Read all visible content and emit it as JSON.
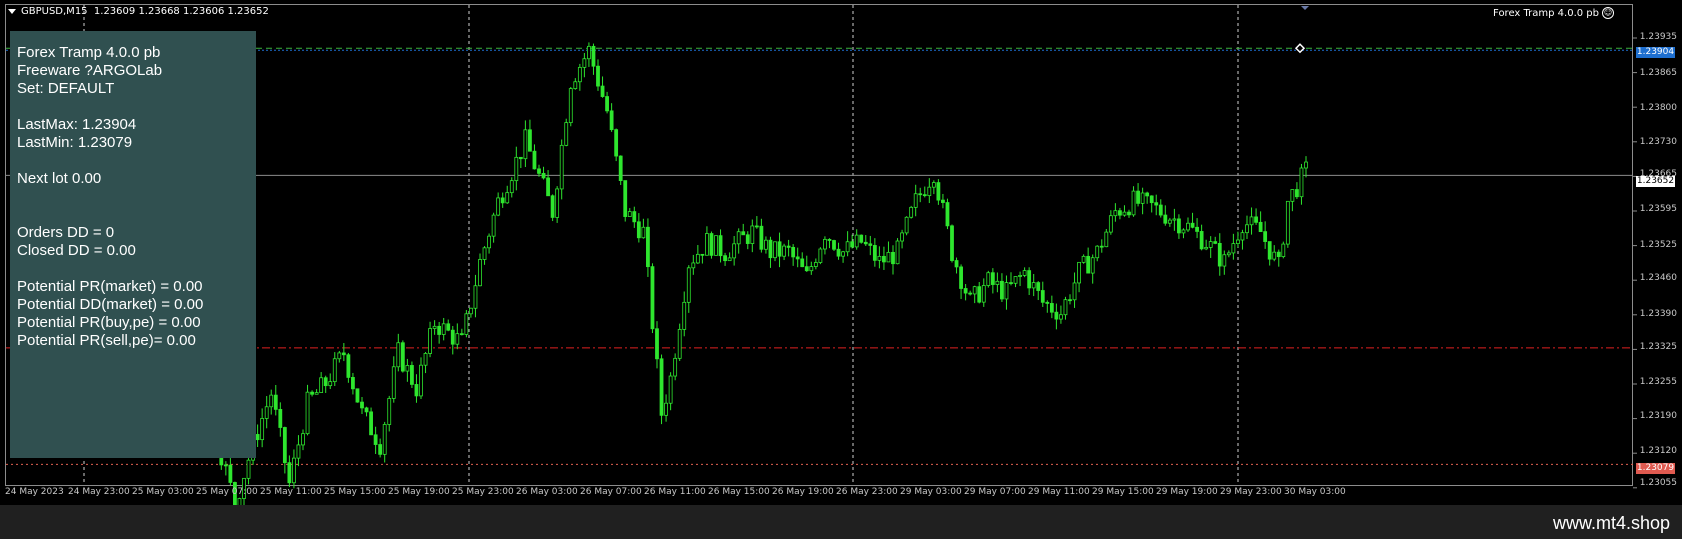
{
  "header": {
    "symbol": "GBPUSD,M15",
    "ohlc": "1.23609 1.23668 1.23606 1.23652",
    "ea_name": "Forex Tramp 4.0.0 pb"
  },
  "panel": {
    "title": "Forex Tramp 4.0.0 pb",
    "vendor": "Freeware ?ARGOLab",
    "set": "Set: DEFAULT",
    "last_max": "LastMax: 1.23904",
    "last_min": "LastMin: 1.23079",
    "next_lot": "Next lot 0.00",
    "orders_dd": "Orders DD = 0",
    "closed_dd": "Closed DD = 0.00",
    "pot_pr_market": "Potential PR(market) = 0.00",
    "pot_dd_market": "Potential DD(market) = 0.00",
    "pot_pr_buy": "Potential PR(buy,pe) = 0.00",
    "pot_pr_sell": "Potential PR(sell,pe)= 0.00"
  },
  "price_axis": [
    "1.23935",
    "1.23865",
    "1.23800",
    "1.23730",
    "1.23665",
    "1.23595",
    "1.23525",
    "1.23460",
    "1.23390",
    "1.23325",
    "1.23255",
    "1.23190",
    "1.23120",
    "1.23055"
  ],
  "price_tags": {
    "max": "1.23904",
    "current": "1.23652",
    "min": "1.23079"
  },
  "time_axis": [
    "24 May 2023",
    "24 May 23:00",
    "25 May 03:00",
    "25 May 07:00",
    "25 May 11:00",
    "25 May 15:00",
    "25 May 19:00",
    "25 May 23:00",
    "26 May 03:00",
    "26 May 07:00",
    "26 May 11:00",
    "26 May 15:00",
    "26 May 19:00",
    "26 May 23:00",
    "29 May 03:00",
    "29 May 07:00",
    "29 May 11:00",
    "29 May 15:00",
    "29 May 19:00",
    "29 May 23:00",
    "30 May 03:00"
  ],
  "chart_data": {
    "type": "candlestick",
    "symbol": "GBPUSD",
    "timeframe": "M15",
    "ylim": [
      1.2304,
      1.2396
    ],
    "levels": {
      "last_max": 1.23904,
      "last_min": 1.23079,
      "current": 1.23652,
      "sell_level": 1.2331
    },
    "close_path": [
      [
        0,
        1.236
      ],
      [
        4,
        1.2366
      ],
      [
        6,
        1.2378
      ],
      [
        8,
        1.2372
      ],
      [
        10,
        1.236
      ],
      [
        12,
        1.2356
      ],
      [
        13,
        1.2374
      ],
      [
        15,
        1.2358
      ],
      [
        17,
        1.2342
      ],
      [
        20,
        1.2325
      ],
      [
        22,
        1.232
      ],
      [
        25,
        1.23
      ],
      [
        27,
        1.2312
      ],
      [
        29,
        1.2322
      ],
      [
        31,
        1.2304
      ],
      [
        33,
        1.232
      ],
      [
        35,
        1.2324
      ],
      [
        37,
        1.233
      ],
      [
        39,
        1.2318
      ],
      [
        41,
        1.2312
      ],
      [
        43,
        1.233
      ],
      [
        45,
        1.2323
      ],
      [
        47,
        1.2336
      ],
      [
        50,
        1.2332
      ],
      [
        52,
        1.2348
      ],
      [
        54,
        1.236
      ],
      [
        57,
        1.2372
      ],
      [
        60,
        1.2358
      ],
      [
        62,
        1.2384
      ],
      [
        64,
        1.239
      ],
      [
        66,
        1.2378
      ],
      [
        68,
        1.2358
      ],
      [
        70,
        1.2354
      ],
      [
        72,
        1.2318
      ],
      [
        73,
        1.2325
      ],
      [
        75,
        1.2348
      ],
      [
        77,
        1.2352
      ],
      [
        79,
        1.235
      ],
      [
        82,
        1.2354
      ],
      [
        84,
        1.235
      ],
      [
        86,
        1.235
      ],
      [
        88,
        1.2345
      ],
      [
        90,
        1.2354
      ],
      [
        92,
        1.235
      ],
      [
        94,
        1.2352
      ],
      [
        96,
        1.2348
      ],
      [
        98,
        1.235
      ],
      [
        100,
        1.236
      ],
      [
        102,
        1.2366
      ],
      [
        104,
        1.235
      ],
      [
        106,
        1.234
      ],
      [
        108,
        1.2344
      ],
      [
        110,
        1.2342
      ],
      [
        112,
        1.2346
      ],
      [
        114,
        1.234
      ],
      [
        116,
        1.2338
      ],
      [
        118,
        1.2346
      ],
      [
        120,
        1.235
      ],
      [
        122,
        1.2358
      ],
      [
        124,
        1.236
      ],
      [
        126,
        1.2359
      ],
      [
        128,
        1.2357
      ],
      [
        130,
        1.2355
      ],
      [
        132,
        1.2352
      ],
      [
        134,
        1.2348
      ],
      [
        136,
        1.2356
      ],
      [
        138,
        1.2354
      ],
      [
        140,
        1.2347
      ],
      [
        141,
        1.236
      ],
      [
        143,
        1.2366
      ]
    ]
  }
}
